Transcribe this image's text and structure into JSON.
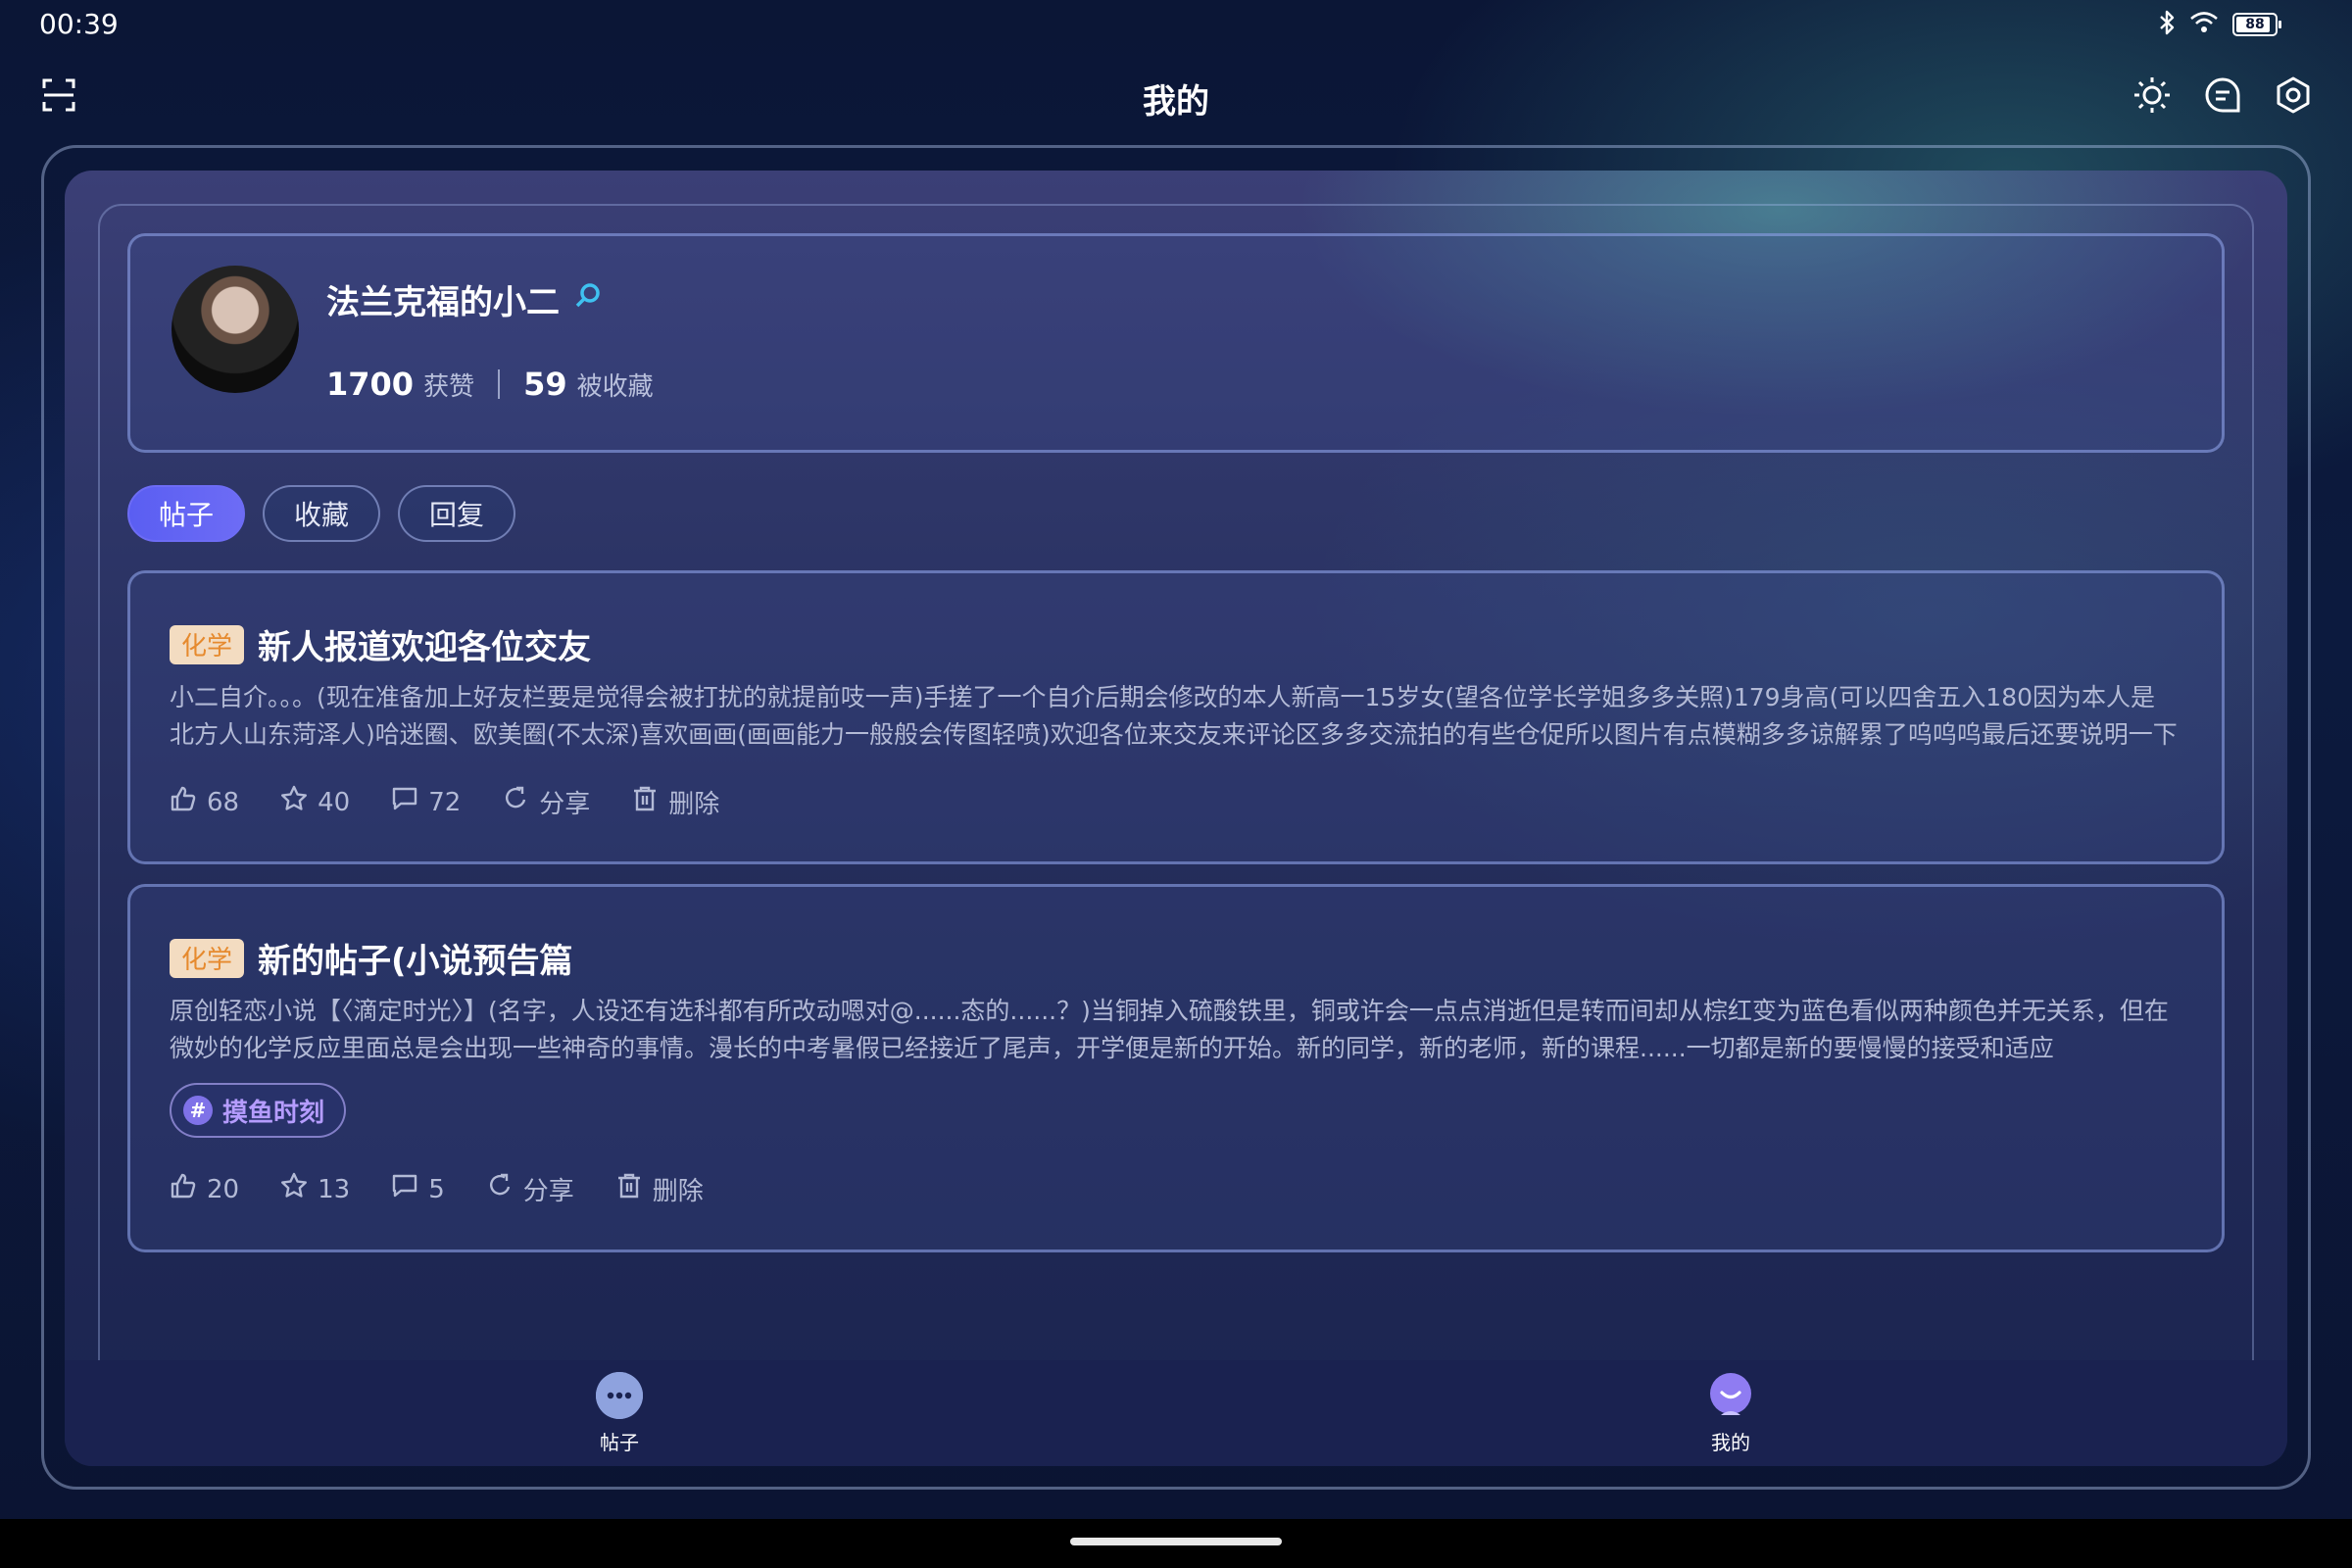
{
  "status": {
    "time": "00:39",
    "battery": "88"
  },
  "header": {
    "title": "我的"
  },
  "profile": {
    "name": "法兰克福的小二",
    "likes_count": "1700",
    "likes_label": "获赞",
    "favorited_count": "59",
    "favorited_label": "被收藏"
  },
  "tabs": [
    {
      "label": "帖子",
      "active": true
    },
    {
      "label": "收藏",
      "active": false
    },
    {
      "label": "回复",
      "active": false
    }
  ],
  "posts": [
    {
      "tag": "化学",
      "title": "新人报道欢迎各位交友",
      "body": " 小二自介。。。(现在准备加上好友栏要是觉得会被打扰的就提前吱一声)手搓了一个自介后期会修改的本人新高一15岁女(望各位学长学姐多多关照)179身高(可以四舍五入180因为本人是北方人山东菏泽人)哈迷圈、欧美圈(不太深)喜欢画画(画画能力一般般会传图轻喷)欢迎各位来交友来评论区多多交流拍的有些仓促所以图片有点模糊多多谅解累了呜呜呜最后还要说明一下",
      "likes": "68",
      "stars": "40",
      "comments": "72",
      "share": "分享",
      "delete": "删除"
    },
    {
      "tag": "化学",
      "title": "新的帖子(小说预告篇",
      "body": "原创轻恋小说【〈滴定时光〉】(名字，人设还有选科都有所改动嗯对@......态的......？)当铜掉入硫酸铁里，铜或许会一点点消逝但是转而间却从棕红变为蓝色看似两种颜色并无关系，但在微妙的化学反应里面总是会出现一些神奇的事情。漫长的中考暑假已经接近了尾声，开学便是新的开始。新的同学，新的老师，新的课程......一切都是新的要慢慢的接受和适应",
      "topic": "摸鱼时刻",
      "likes": "20",
      "stars": "13",
      "comments": "5",
      "share": "分享",
      "delete": "删除"
    }
  ],
  "bottom_nav": [
    {
      "label": "帖子"
    },
    {
      "label": "我的"
    }
  ],
  "colors": {
    "accent": "#6d6cf5",
    "tag_bg": "#f3dcc1",
    "tag_text": "#e68a2e",
    "topic_text": "#b59cff"
  },
  "icons": {
    "scan": "scan-icon",
    "brightness": "sun-icon",
    "messages": "chat-icon",
    "settings": "settings-icon",
    "like": "thumbs-up-icon",
    "star": "star-icon",
    "comment": "comment-icon",
    "share": "share-icon",
    "delete": "trash-icon"
  }
}
